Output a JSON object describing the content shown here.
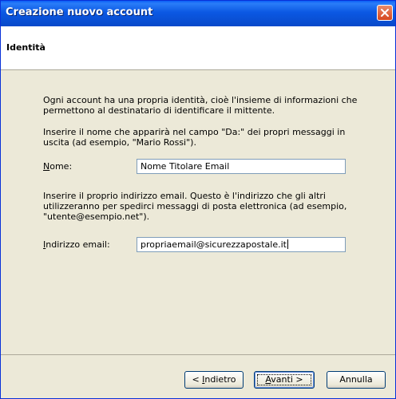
{
  "window": {
    "title": "Creazione nuovo account"
  },
  "header": {
    "title": "Identità"
  },
  "content": {
    "intro": "Ogni account ha una propria identità, cioè l'insieme di informazioni che\npermettono al destinatario di identificare il mittente.",
    "name_instruction": "Inserire il nome che apparirà nel campo \"Da:\" dei propri messaggi in\nuscita (ad esempio, \"Mario Rossi\").",
    "name_label_first": "N",
    "name_label_rest": "ome:",
    "name_value": "Nome Titolare Email",
    "email_instruction": "Inserire il proprio indirizzo email. Questo è l'indirizzo che gli altri\nutilizzeranno per spedirci messaggi di posta elettronica (ad esempio,\n\"utente@esempio.net\").",
    "email_label_first": "I",
    "email_label_rest": "ndirizzo email:",
    "email_value": "propriaemail@sicurezzapostale.it"
  },
  "buttons": {
    "back_pre": "< ",
    "back_ul": "I",
    "back_post": "ndietro",
    "next_ul": "A",
    "next_post": "vanti >",
    "cancel": "Annulla"
  },
  "colors": {
    "titlebar": "#0b58e3",
    "close": "#d6461e",
    "dialog_bg": "#ece9d8"
  }
}
